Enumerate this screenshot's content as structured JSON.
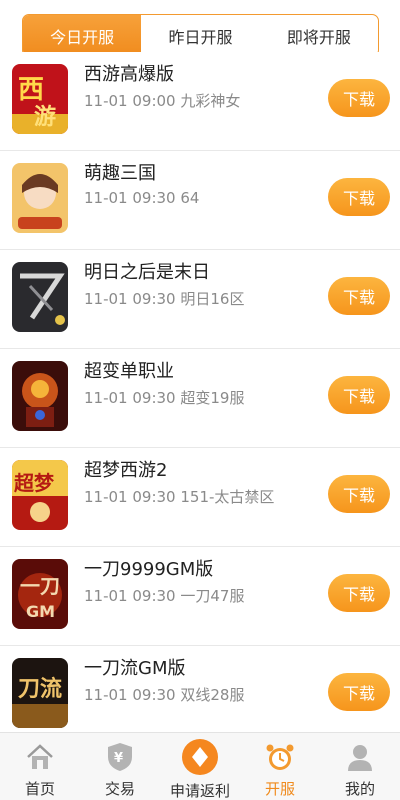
{
  "tabs": [
    {
      "label": "今日开服",
      "active": true
    },
    {
      "label": "昨日开服",
      "active": false
    },
    {
      "label": "即将开服",
      "active": false
    }
  ],
  "games": [
    {
      "title": "西游高爆版",
      "time": "11-01 09:00",
      "server": "九彩神女",
      "icon": "xiyou-game-icon",
      "button": "下载"
    },
    {
      "title": "萌趣三国",
      "time": "11-01 09:30",
      "server": "64",
      "icon": "mengqu-game-icon",
      "button": "下载"
    },
    {
      "title": "明日之后是末日",
      "time": "11-01 09:30",
      "server": "明日16区",
      "icon": "mingri-game-icon",
      "button": "下载"
    },
    {
      "title": "超变单职业",
      "time": "11-01 09:30",
      "server": "超变19服",
      "icon": "chaobian-game-icon",
      "button": "下载"
    },
    {
      "title": "超梦西游2",
      "time": "11-01 09:30",
      "server": "151-太古禁区",
      "icon": "chaomeng-game-icon",
      "button": "下载"
    },
    {
      "title": "一刀9999GM版",
      "time": "11-01 09:30",
      "server": "一刀47服",
      "icon": "yidao-game-icon",
      "button": "下载"
    },
    {
      "title": "一刀流GM版",
      "time": "11-01 09:30",
      "server": "双线28服",
      "icon": "yidaoliu-game-icon",
      "button": "下载"
    }
  ],
  "nav": [
    {
      "label": "首页",
      "icon": "home-icon",
      "active": false
    },
    {
      "label": "交易",
      "icon": "trade-shield-icon",
      "active": false
    },
    {
      "label": "申请返利",
      "icon": "rebate-diamond-icon",
      "active": false
    },
    {
      "label": "开服",
      "icon": "alarm-clock-icon",
      "active": true
    },
    {
      "label": "我的",
      "icon": "user-icon",
      "active": false
    }
  ],
  "colors": {
    "accent": "#f39a2f",
    "button": "#f6951c",
    "meta_text": "#8a8a8a",
    "nav_bg": "#f7f7f7"
  }
}
